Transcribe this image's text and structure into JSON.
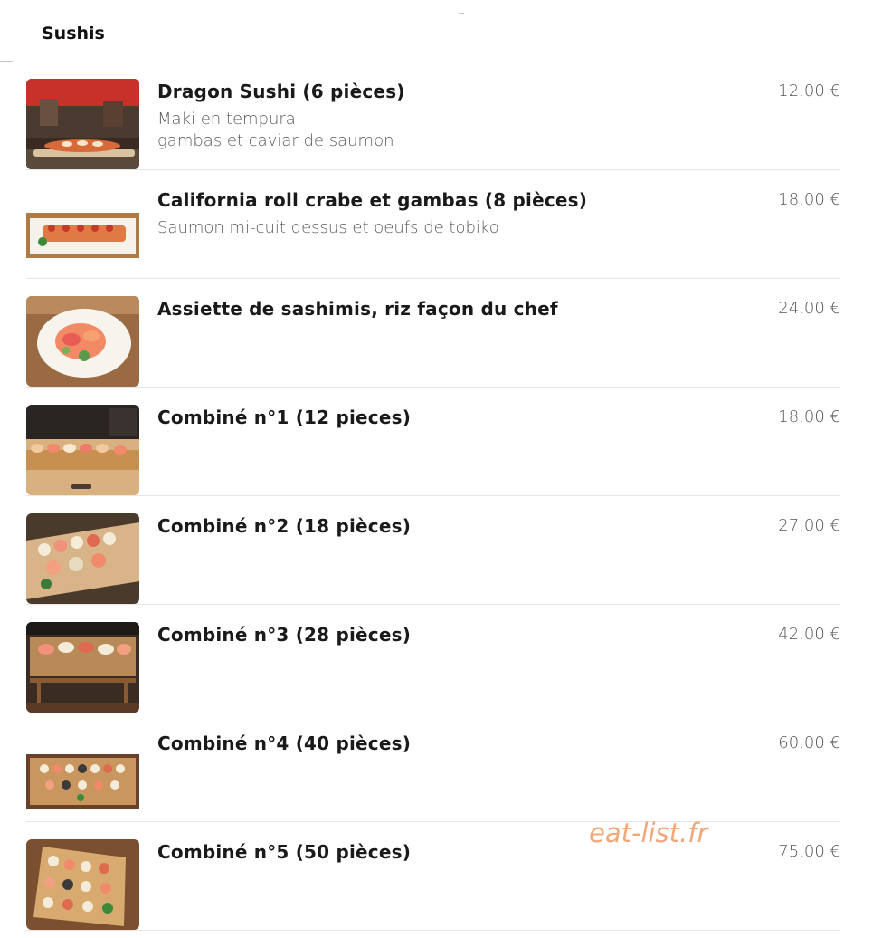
{
  "section": {
    "title": "Sushis"
  },
  "watermark": "eat-list.fr",
  "items": [
    {
      "name": "Dragon Sushi (6 pièces)",
      "desc": [
        "Maki en tempura",
        "gambas et caviar de saumon"
      ],
      "price": "12.00 €",
      "image": "dragon-sushi-photo"
    },
    {
      "name": "California roll crabe et gambas (8 pièces)",
      "desc": [
        "Saumon mi-cuit dessus et oeufs de tobiko"
      ],
      "price": "18.00 €",
      "image": "california-roll-photo"
    },
    {
      "name": "Assiette de sashimis, riz façon du chef",
      "desc": [],
      "price": "24.00 €",
      "image": "sashimi-plate-photo"
    },
    {
      "name": "Combiné n°1 (12 pieces)",
      "desc": [],
      "price": "18.00 €",
      "image": "combine-1-photo"
    },
    {
      "name": "Combiné n°2 (18 pièces)",
      "desc": [],
      "price": "27.00 €",
      "image": "combine-2-photo"
    },
    {
      "name": "Combiné n°3 (28 pièces)",
      "desc": [],
      "price": "42.00 €",
      "image": "combine-3-photo"
    },
    {
      "name": "Combiné n°4 (40 pièces)",
      "desc": [],
      "price": "60.00 €",
      "image": "combine-4-photo"
    },
    {
      "name": "Combiné n°5 (50 pièces)",
      "desc": [],
      "price": "75.00 €",
      "image": "combine-5-photo"
    }
  ]
}
